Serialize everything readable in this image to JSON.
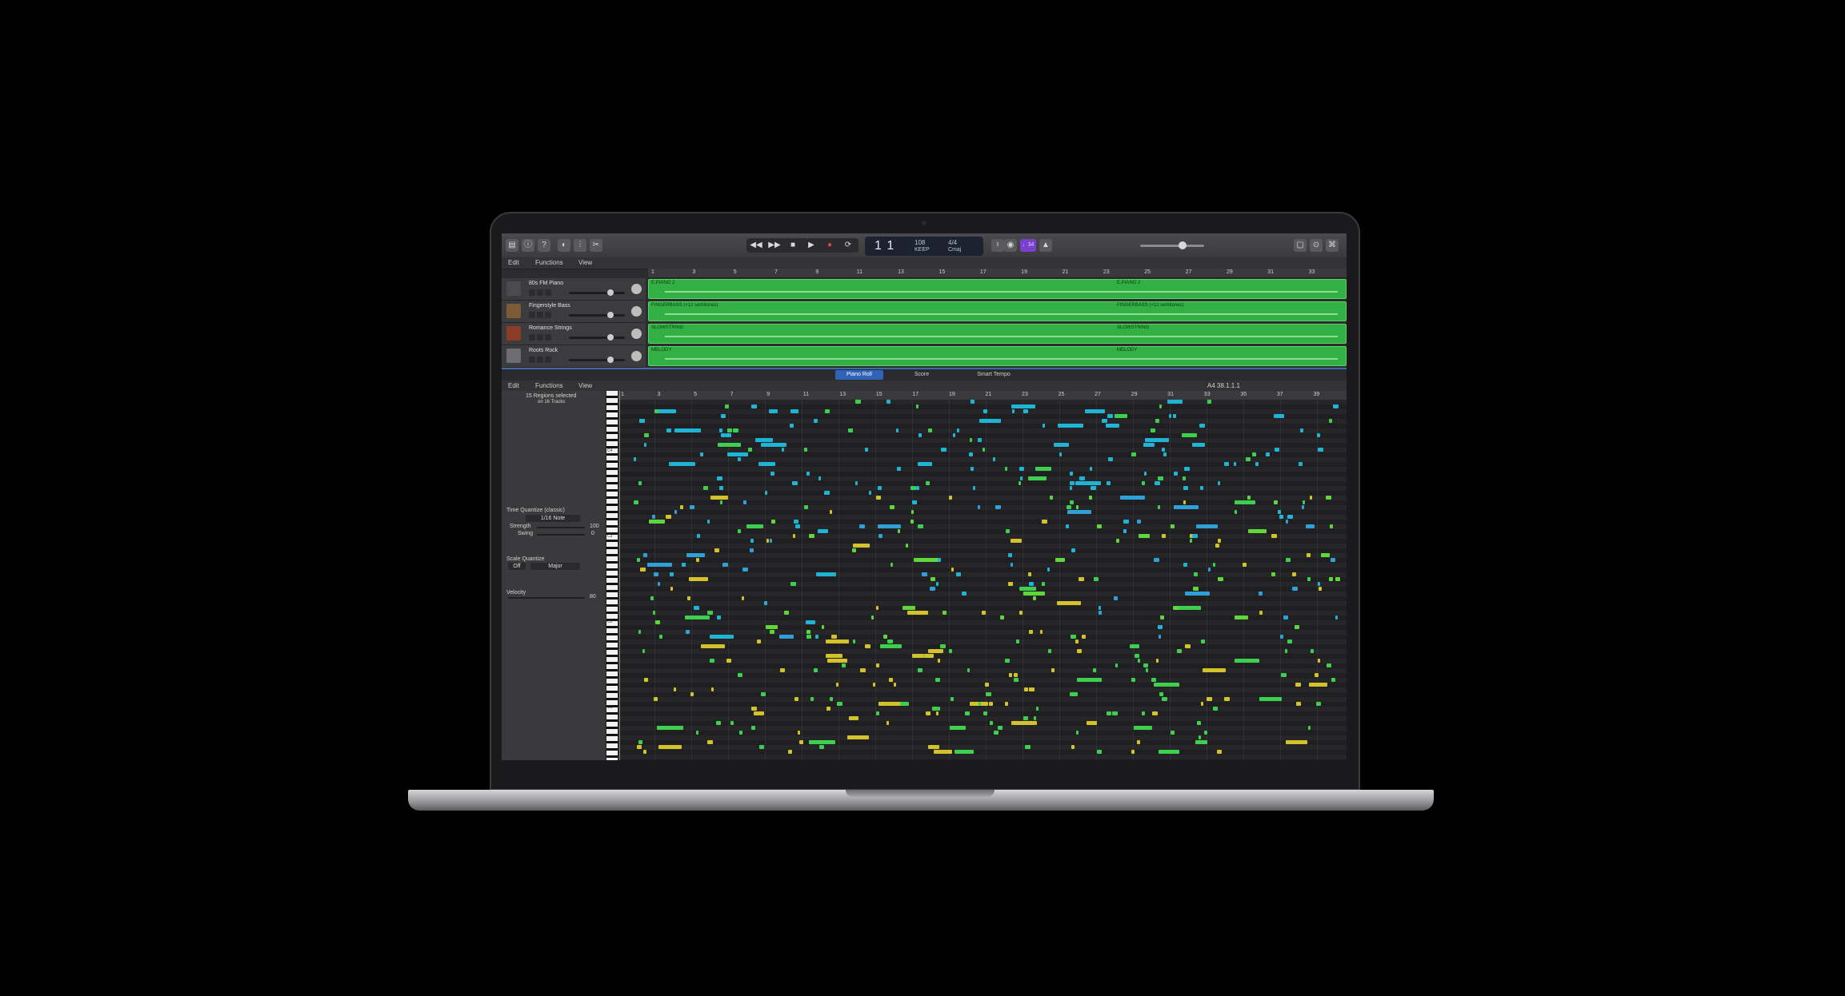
{
  "control_bar": {
    "lcd_position": "1 1",
    "lcd_tempo": "108",
    "lcd_tempo_label": "KEEP",
    "lcd_signature": "4/4",
    "lcd_key": "Cmaj",
    "count_in": "♩34"
  },
  "tracks_menu": {
    "edit": "Edit",
    "functions": "Functions",
    "view": "View"
  },
  "tracks_ruler": [
    "1",
    "3",
    "5",
    "7",
    "9",
    "11",
    "13",
    "15",
    "17",
    "19",
    "21",
    "23",
    "25",
    "27",
    "29",
    "31",
    "33"
  ],
  "tracks": [
    {
      "name": "80s FM Piano",
      "region": "E.PIANO 2",
      "region2": "E.PIANO 2"
    },
    {
      "name": "Fingerstyle Bass",
      "region": "FINGERBASS (+12 semitones)",
      "region2": "FINGERBASS (+12 semitones)"
    },
    {
      "name": "Romance Strings",
      "region": "SLOWSTRING",
      "region2": "SLOWSTRING"
    },
    {
      "name": "Roots Rock",
      "region": "MELODY",
      "region2": "MELODY"
    }
  ],
  "editor_tabs": {
    "piano_roll": "Piano Roll",
    "score": "Score",
    "smart_tempo": "Smart Tempo"
  },
  "editor_menu": {
    "edit": "Edit",
    "functions": "Functions",
    "view": "View",
    "position": "A4  38.1.1.1"
  },
  "inspector": {
    "regions_selected": "15 Regions selected",
    "regions_sub": "on 16 Tracks",
    "time_quantize_label": "Time Quantize (classic)",
    "time_quantize_value": "1/16 Note",
    "strength_label": "Strength",
    "strength_value": "100",
    "swing_label": "Swing",
    "swing_value": "0",
    "scale_quantize_label": "Scale Quantize",
    "scale_off": "Off",
    "scale_mode": "Major",
    "velocity_label": "Velocity",
    "velocity_value": "80"
  },
  "piano_ruler": [
    "1",
    "3",
    "5",
    "7",
    "9",
    "11",
    "13",
    "15",
    "17",
    "19",
    "21",
    "23",
    "25",
    "27",
    "29",
    "31",
    "33",
    "35",
    "37",
    "39"
  ],
  "piano_keys": [
    "C4",
    "C3",
    "C2",
    "C1"
  ],
  "colors": {
    "region_green": "#33b043",
    "note_cyan": "#1fb4d6",
    "note_green": "#3fcf4e",
    "note_yellow": "#d4c22a",
    "tab_blue": "#2f63b8"
  }
}
